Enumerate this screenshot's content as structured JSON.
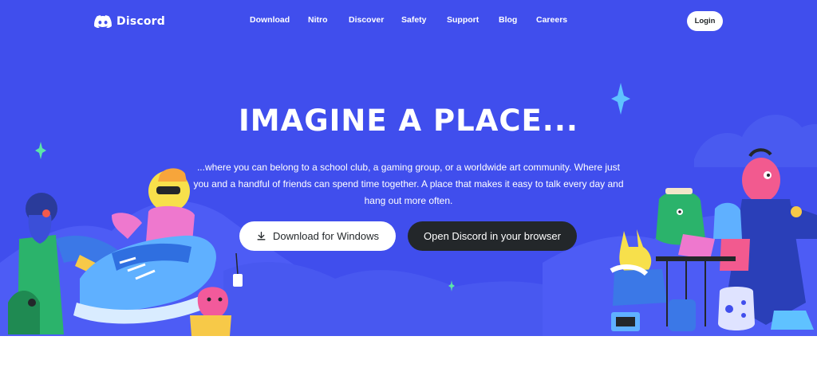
{
  "brand": {
    "name": "Discord",
    "logo_icon": "discord-logo-icon"
  },
  "nav": {
    "links": [
      {
        "label": "Download"
      },
      {
        "label": "Nitro"
      },
      {
        "label": "Discover"
      },
      {
        "label": "Safety"
      },
      {
        "label": "Support"
      },
      {
        "label": "Blog"
      },
      {
        "label": "Careers"
      }
    ],
    "login_label": "Login"
  },
  "hero": {
    "headline": "IMAGINE A PLACE...",
    "subtext": "...where you can belong to a school club, a gaming group, or a worldwide art community. Where just you and a handful of friends can spend time together. A place that makes it easy to talk every day and hang out more often.",
    "download_button": {
      "label": "Download for Windows",
      "icon": "download-icon"
    },
    "browser_button": {
      "label": "Open Discord in your browser"
    }
  },
  "colors": {
    "blurple": "#404eed",
    "button_dark": "#23272a",
    "white": "#ffffff",
    "sparkle_green": "#5be5a8",
    "sparkle_blue": "#5fc2ff"
  }
}
